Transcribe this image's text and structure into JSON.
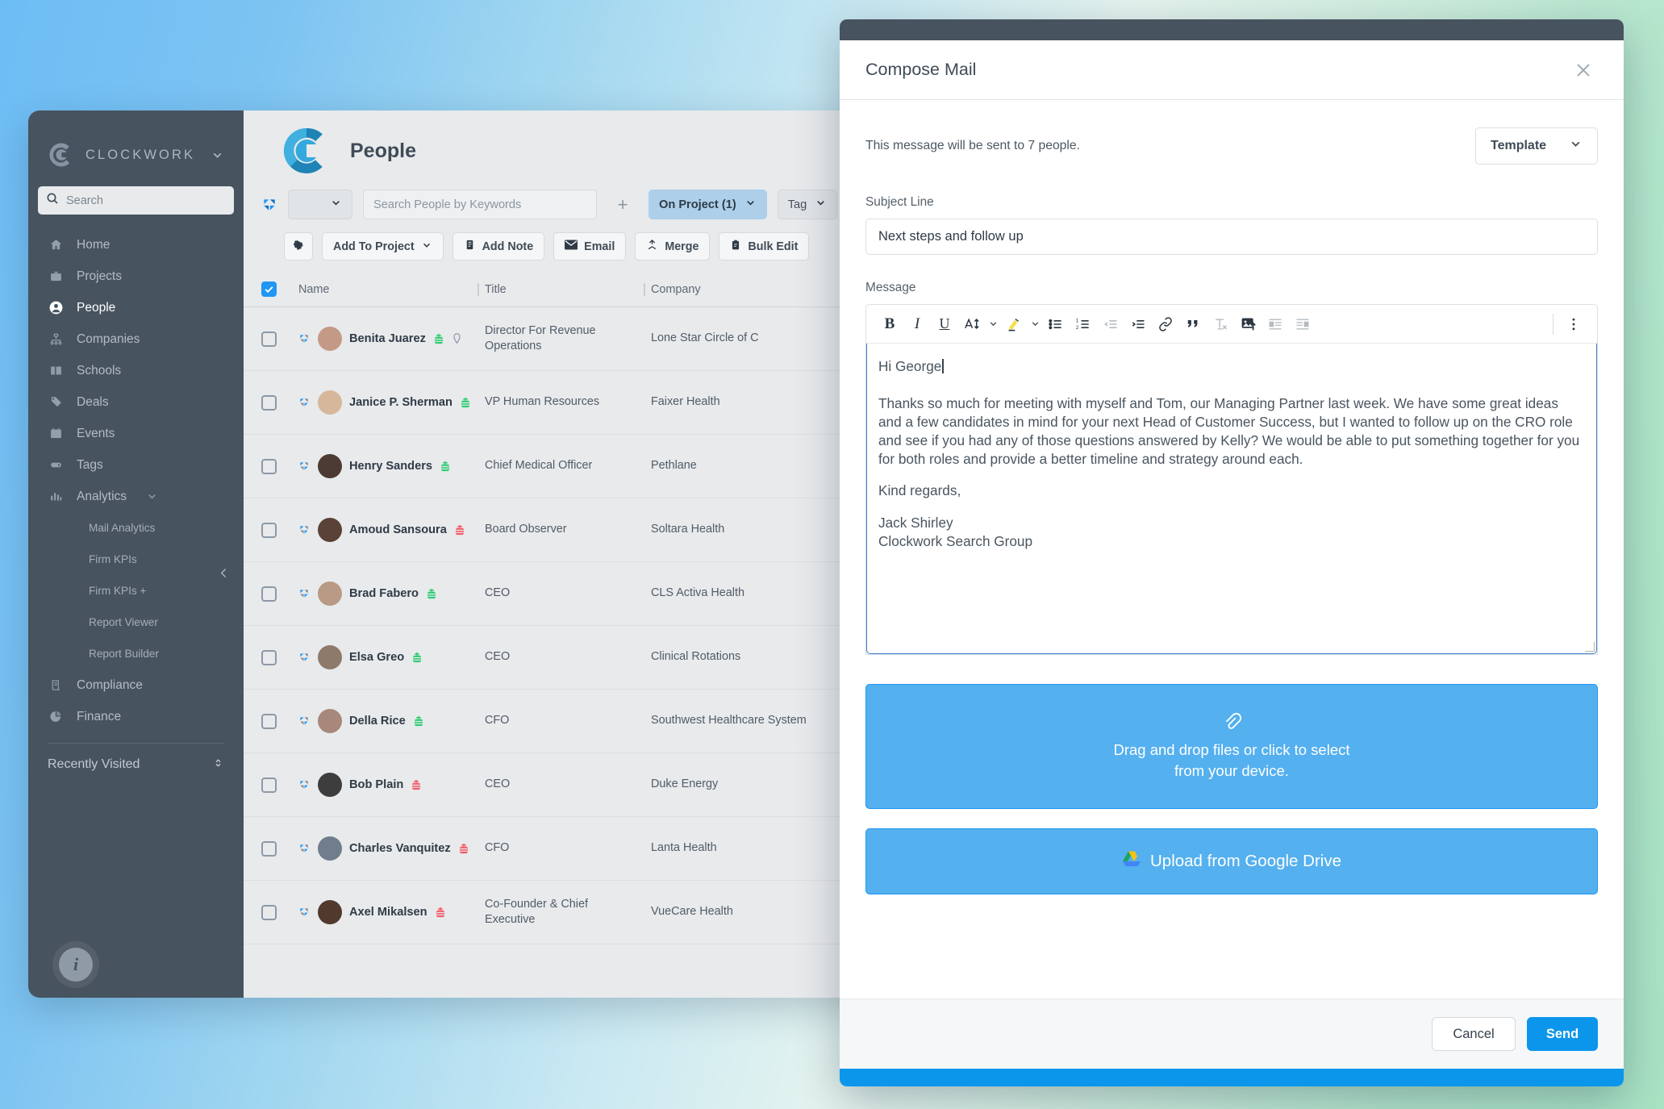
{
  "sidebar": {
    "brand": "CLOCKWORK",
    "search_placeholder": "Search",
    "items": [
      {
        "label": "Home",
        "icon": "home-icon"
      },
      {
        "label": "Projects",
        "icon": "briefcase-icon"
      },
      {
        "label": "People",
        "icon": "person-icon"
      },
      {
        "label": "Companies",
        "icon": "org-chart-icon"
      },
      {
        "label": "Schools",
        "icon": "book-icon"
      },
      {
        "label": "Deals",
        "icon": "tag-icon"
      },
      {
        "label": "Events",
        "icon": "calendar-icon"
      },
      {
        "label": "Tags",
        "icon": "label-icon"
      },
      {
        "label": "Analytics",
        "icon": "bar-chart-icon"
      }
    ],
    "analytics_children": [
      "Mail Analytics",
      "Firm KPIs",
      "Firm KPIs +",
      "Report Viewer",
      "Report Builder"
    ],
    "items_after": [
      {
        "label": "Compliance",
        "icon": "scroll-icon"
      },
      {
        "label": "Finance",
        "icon": "pie-chart-icon"
      }
    ],
    "recently_visited": "Recently Visited",
    "info_label": "i"
  },
  "page": {
    "title": "People",
    "search_placeholder": "Search People by Keywords",
    "filter_chips": [
      {
        "label": "On Project (1)",
        "active": true
      },
      {
        "label": "Tag",
        "active": false
      }
    ],
    "actions": [
      {
        "label": "Add To Project",
        "icon": "chevron-down-icon",
        "has_caret": true
      },
      {
        "label": "Add Note",
        "icon": "note-icon"
      },
      {
        "label": "Email",
        "icon": "envelope-icon"
      },
      {
        "label": "Merge",
        "icon": "merge-icon"
      },
      {
        "label": "Bulk Edit",
        "icon": "clipboard-icon"
      }
    ],
    "gear_label": "gear-icon",
    "plus_label": "+"
  },
  "table": {
    "columns": [
      "Name",
      "Title",
      "Company"
    ],
    "header_checkbox_checked": true,
    "rows": [
      {
        "name": "Benita Juarez",
        "title": "Director For Revenue Operations",
        "company": "Lone Star Circle of C",
        "badge": "green",
        "extra_icon": "location-pin-icon",
        "avatar": "#c49a86"
      },
      {
        "name": "Janice P. Sherman",
        "title": "VP Human Resources",
        "company": "Faixer Health",
        "badge": "green",
        "extra_icon": "",
        "avatar": "#d7b79b"
      },
      {
        "name": "Henry Sanders",
        "title": "Chief Medical Officer",
        "company": "Pethlane",
        "badge": "green",
        "extra_icon": "",
        "avatar": "#4c3b34"
      },
      {
        "name": "Amoud Sansoura",
        "title": "Board Observer",
        "company": "Soltara Health",
        "badge": "red",
        "extra_icon": "",
        "avatar": "#5a4238"
      },
      {
        "name": "Brad Fabero",
        "title": "CEO",
        "company": "CLS Activa Health",
        "badge": "green",
        "extra_icon": "",
        "avatar": "#b89a85"
      },
      {
        "name": "Elsa Greo",
        "title": "CEO",
        "company": "Clinical Rotations",
        "badge": "green",
        "extra_icon": "",
        "avatar": "#8e7a6b"
      },
      {
        "name": "Della Rice",
        "title": "CFO",
        "company": "Southwest Healthcare System",
        "badge": "green",
        "extra_icon": "",
        "avatar": "#a8887a"
      },
      {
        "name": "Bob Plain",
        "title": "CEO",
        "company": "Duke Energy",
        "badge": "red",
        "extra_icon": "",
        "avatar": "#3d3d3d"
      },
      {
        "name": "Charles Vanquitez",
        "title": "CFO",
        "company": "Lanta Health",
        "badge": "red",
        "extra_icon": "",
        "avatar": "#6f7d8c"
      },
      {
        "name": "Axel Mikalsen",
        "title": "Co-Founder & Chief Executive",
        "company": "VueCare Health",
        "badge": "red",
        "extra_icon": "",
        "avatar": "#51392e"
      }
    ]
  },
  "modal": {
    "title": "Compose Mail",
    "close_icon": "close-icon",
    "recipients_text": "This message will be sent to 7 people.",
    "template_label": "Template",
    "subject_label": "Subject Line",
    "subject_value": "Next steps and follow up",
    "message_label": "Message",
    "toolbar": [
      {
        "name": "bold-icon",
        "glyph": "B"
      },
      {
        "name": "italic-icon",
        "glyph": "I"
      },
      {
        "name": "underline-icon",
        "glyph": "U"
      },
      {
        "name": "font-size-icon",
        "glyph": "A"
      },
      {
        "name": "highlight-icon",
        "glyph": "pen"
      },
      {
        "name": "bulleted-list-icon",
        "glyph": "ul"
      },
      {
        "name": "numbered-list-icon",
        "glyph": "ol"
      },
      {
        "name": "outdent-icon",
        "glyph": "outdent"
      },
      {
        "name": "indent-icon",
        "glyph": "indent"
      },
      {
        "name": "link-icon",
        "glyph": "link"
      },
      {
        "name": "blockquote-icon",
        "glyph": "quote"
      },
      {
        "name": "clear-format-icon",
        "glyph": "Tx"
      },
      {
        "name": "insert-image-icon",
        "glyph": "image"
      },
      {
        "name": "align-image-left-icon",
        "glyph": "imgleft"
      },
      {
        "name": "align-image-right-icon",
        "glyph": "imgright"
      },
      {
        "name": "more-options-icon",
        "glyph": "kebab"
      }
    ],
    "message": {
      "greeting": "Hi  George",
      "paragraph": "Thanks so much for meeting with myself and Tom, our Managing Partner last week. We have some great ideas and a few candidates in mind for your next Head of Customer Success, but I wanted to follow up on the CRO role and see if you had any of those questions answered by Kelly? We would be able to put something together for you for both roles and provide a better timeline and strategy around each.",
      "closing": "Kind regards,",
      "signature_name": "Jack Shirley",
      "signature_org": "Clockwork Search Group"
    },
    "dropzone_line1": "Drag and drop files or click to select",
    "dropzone_line2": "from your device.",
    "gdrive_label": "Upload from Google Drive",
    "cancel_label": "Cancel",
    "send_label": "Send"
  },
  "colors": {
    "sidebar_bg": "#47535f",
    "accent_blue": "#0b96ec",
    "chip_blue": "#adcfea",
    "dropzone_blue": "#54b0ef",
    "badge_green": "#2ecc71",
    "badge_red": "#f45b69"
  }
}
